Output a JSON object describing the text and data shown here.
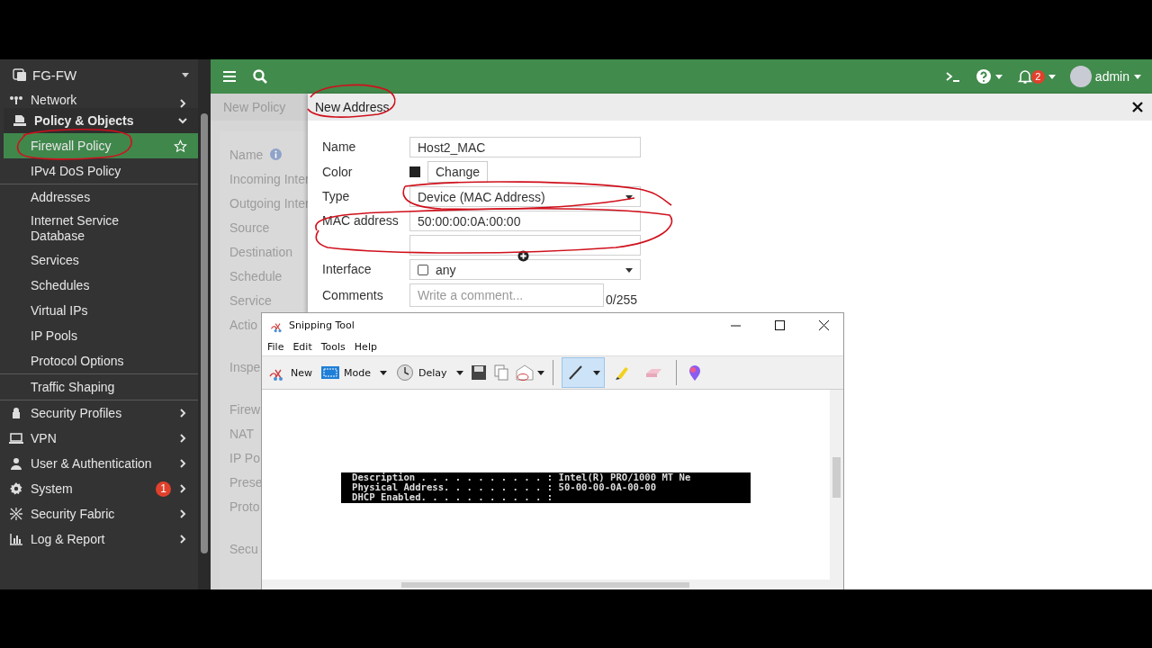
{
  "sidebar": {
    "device": "FG-FW",
    "items": [
      {
        "label": "Network",
        "expanded": false
      },
      {
        "label": "Policy & Objects",
        "expanded": true,
        "sections": [
          {
            "children": [
              {
                "label": "Firewall Policy",
                "selected": true
              },
              {
                "label": "IPv4 DoS Policy",
                "selected": false
              }
            ]
          },
          {
            "children": [
              {
                "label": "Addresses",
                "selected": false
              },
              {
                "label": "Internet Service Database",
                "selected": false
              },
              {
                "label": "Services",
                "selected": false
              },
              {
                "label": "Schedules",
                "selected": false
              },
              {
                "label": "Virtual IPs",
                "selected": false
              },
              {
                "label": "IP Pools",
                "selected": false
              },
              {
                "label": "Protocol Options",
                "selected": false
              }
            ]
          },
          {
            "children": [
              {
                "label": "Traffic Shaping",
                "selected": false
              }
            ]
          }
        ]
      },
      {
        "label": "Security Profiles",
        "expanded": false
      },
      {
        "label": "VPN",
        "expanded": false
      },
      {
        "label": "User & Authentication",
        "expanded": false
      },
      {
        "label": "System",
        "expanded": false,
        "badge": "1"
      },
      {
        "label": "Security Fabric",
        "expanded": false
      },
      {
        "label": "Log & Report",
        "expanded": false
      }
    ]
  },
  "header": {
    "notifications": "2",
    "user": "admin"
  },
  "policy_page": {
    "title": "New Policy",
    "sections": [
      {
        "labels": [
          {
            "label": "Name",
            "info": true
          },
          {
            "label": "Incoming Inter"
          },
          {
            "label": "Outgoing Inter"
          },
          {
            "label": "Source"
          },
          {
            "label": "Destination"
          },
          {
            "label": "Schedule"
          },
          {
            "label": "Service"
          },
          {
            "label": "Actio"
          }
        ]
      },
      {
        "labels": [
          {
            "label": "Inspe"
          }
        ]
      },
      {
        "labels": [
          {
            "label": "Firew"
          },
          {
            "label": "NAT"
          },
          {
            "label": "IP Po"
          },
          {
            "label": "Prese"
          },
          {
            "label": "Proto"
          }
        ]
      },
      {
        "labels": [
          {
            "label": "Secu"
          }
        ]
      }
    ]
  },
  "panel": {
    "title": "New Address",
    "fields": [
      {
        "kind": "text",
        "label": "Name",
        "value": "Host2_MAC"
      },
      {
        "kind": "color",
        "label": "Color",
        "button": "Change"
      },
      {
        "kind": "select",
        "label": "Type",
        "value": "Device (MAC Address)"
      },
      {
        "kind": "mac",
        "label": "MAC address",
        "value": "50:00:00:0A:00:00"
      },
      {
        "kind": "interface",
        "label": "Interface",
        "checked": false,
        "value": "any"
      },
      {
        "kind": "textarea",
        "label": "Comments",
        "placeholder": "Write a comment...",
        "counter": "0/255"
      }
    ]
  },
  "snipping_tool": {
    "title": "Snipping Tool",
    "menu": [
      "File",
      "Edit",
      "Tools",
      "Help"
    ],
    "buttons": [
      {
        "label": "New",
        "dropdown": false
      },
      {
        "label": "Mode",
        "dropdown": true
      },
      {
        "label": "Delay",
        "dropdown": true
      }
    ],
    "tools": [
      {
        "selected": true
      },
      {
        "selected": false
      },
      {
        "selected": false
      }
    ],
    "console": [
      "Description . . . . . . . . . . . : Intel(R) PRO/1000 MT Ne",
      "Physical Address. . . . . . . . . : 50-00-00-0A-00-00",
      "DHCP Enabled. . . . . . . . . . . :"
    ]
  }
}
